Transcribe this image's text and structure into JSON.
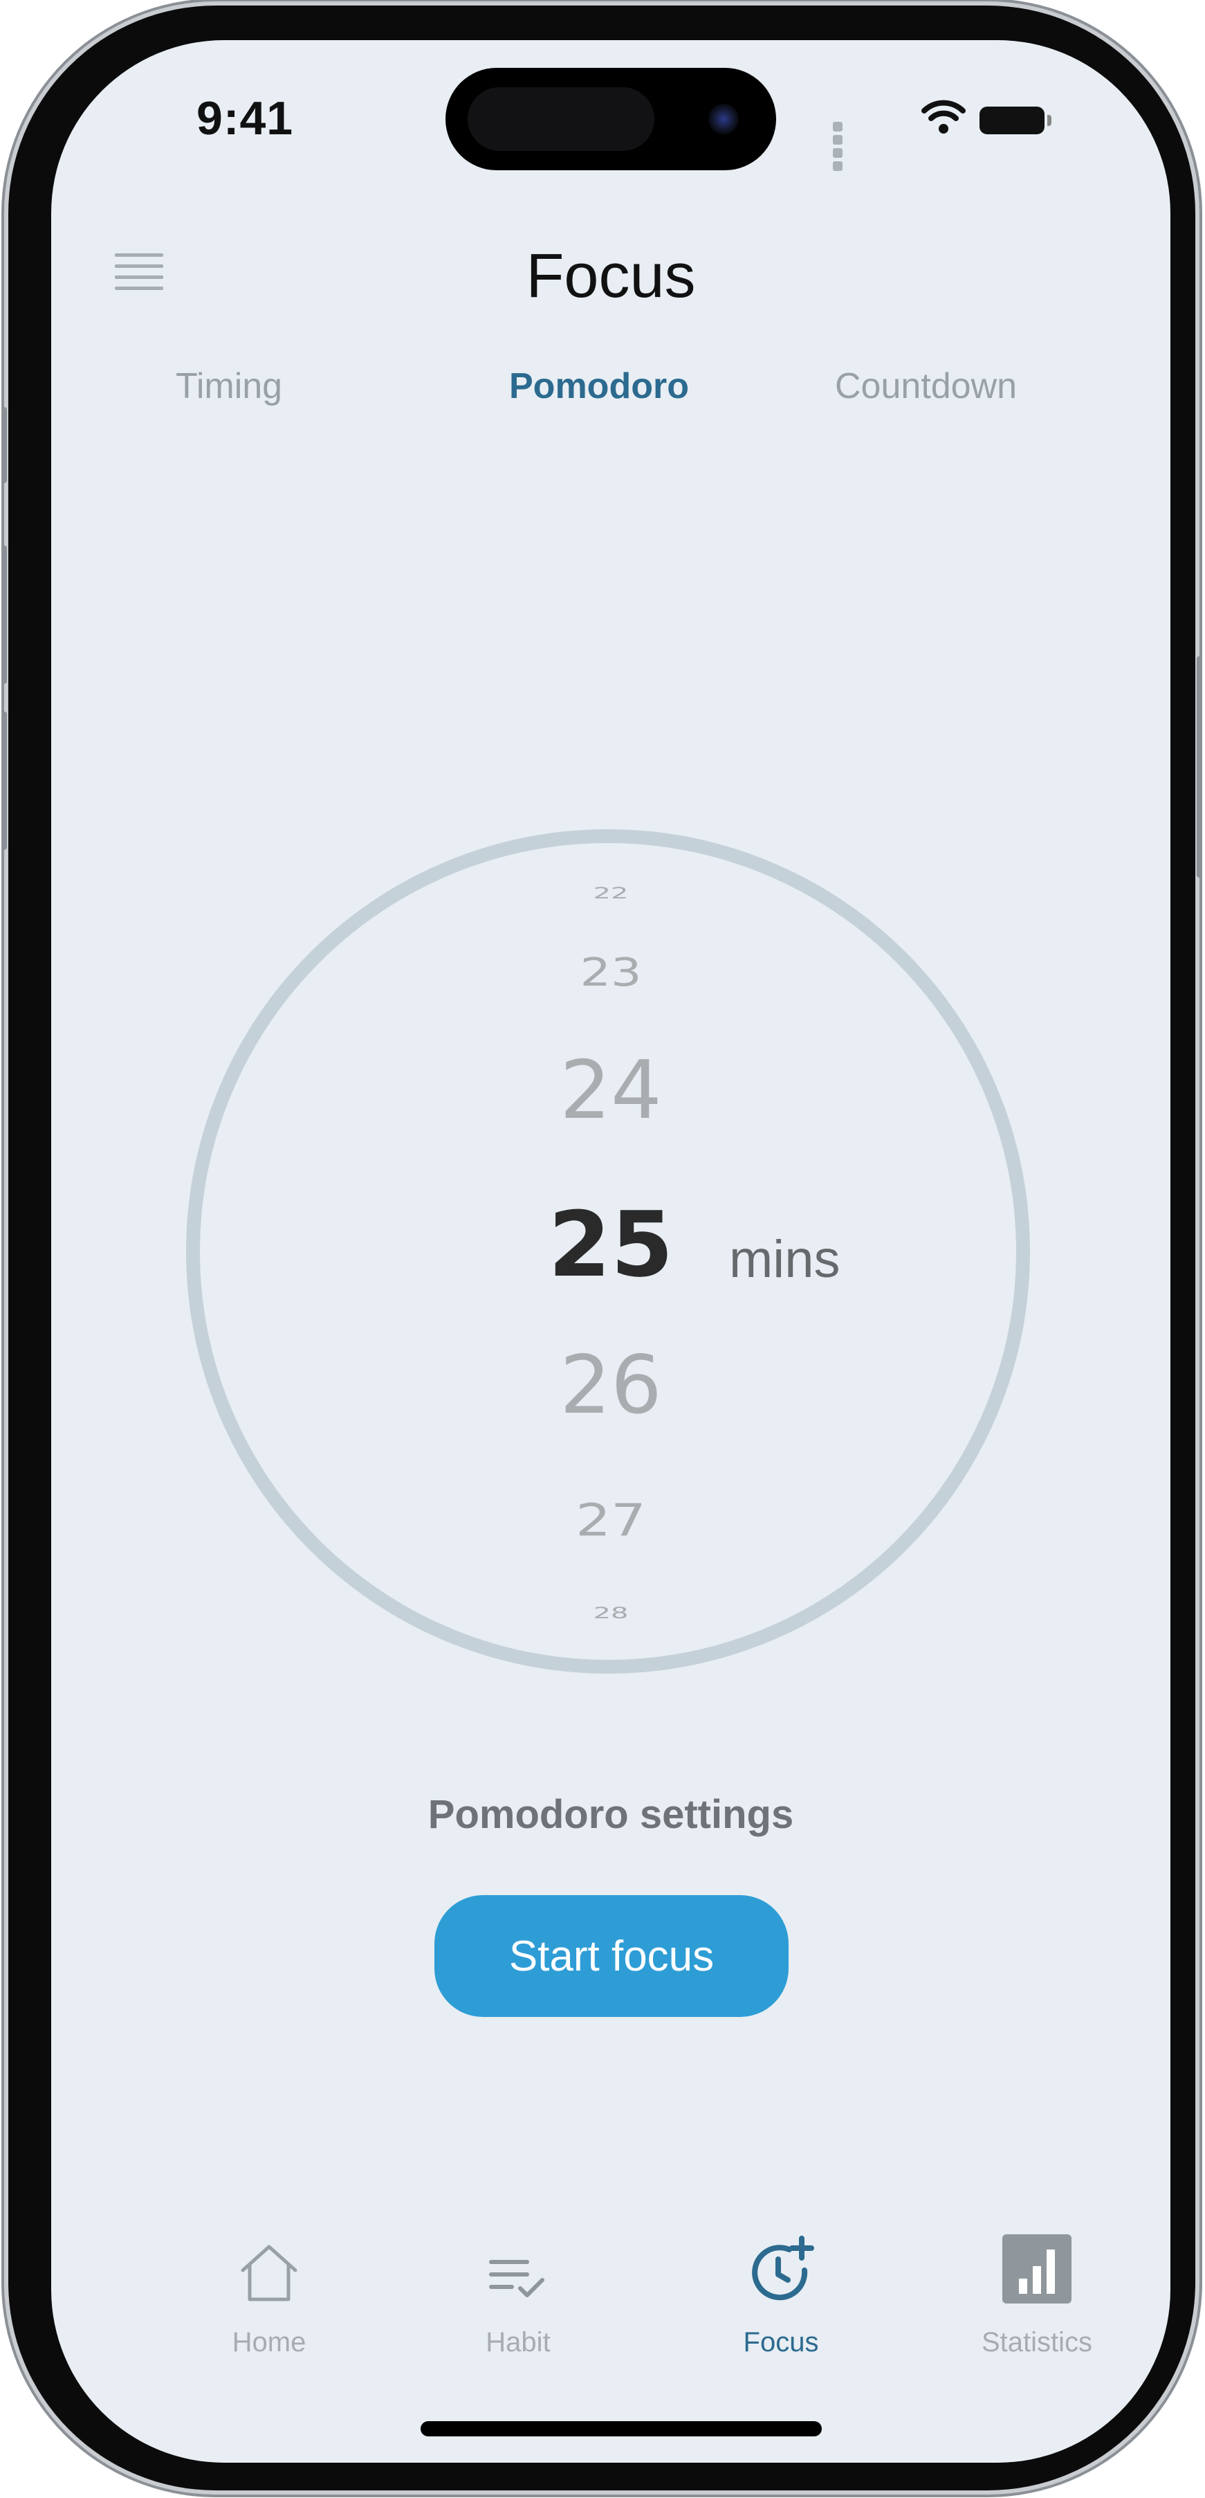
{
  "status_bar": {
    "time": "9:41"
  },
  "header": {
    "title": "Focus",
    "menu_icon": "menu-icon"
  },
  "tabs": [
    {
      "label": "Timing",
      "active": false
    },
    {
      "label": "Pomodoro",
      "active": true
    },
    {
      "label": "Countdown",
      "active": false
    }
  ],
  "picker": {
    "values": [
      "22",
      "23",
      "24",
      "25",
      "26",
      "27",
      "28"
    ],
    "selected": "25",
    "unit": "mins"
  },
  "settings_link": "Pomodoro settings",
  "start_button": "Start focus",
  "bottom_nav": [
    {
      "label": "Home",
      "icon": "home-icon",
      "active": false
    },
    {
      "label": "Habit",
      "icon": "habit-list-icon",
      "active": false
    },
    {
      "label": "Focus",
      "icon": "focus-clock-icon",
      "active": true
    },
    {
      "label": "Statistics",
      "icon": "statistics-icon",
      "active": false
    }
  ],
  "colors": {
    "background": "#e8eef3",
    "accent": "#2c6a8f",
    "button": "#2e9dd6",
    "dial_ring": "#c5d1d9",
    "inactive": "#a6acb0"
  }
}
